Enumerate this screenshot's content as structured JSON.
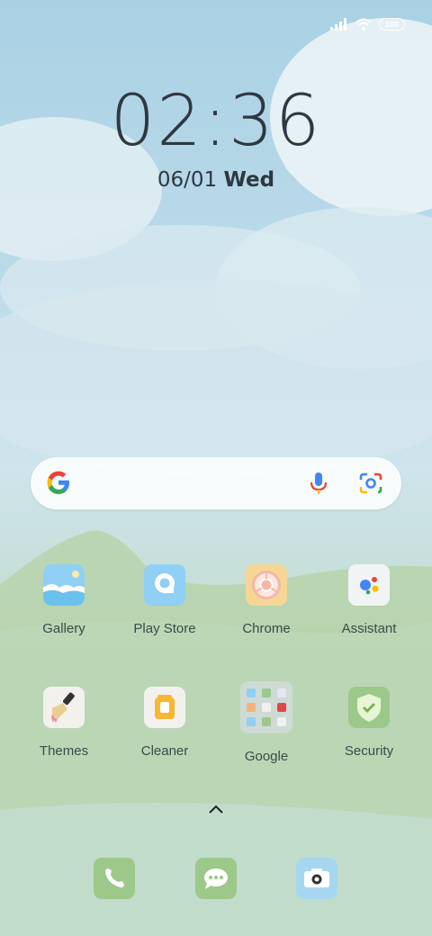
{
  "status_bar": {
    "badge": "100"
  },
  "lock": {
    "time": "02:36",
    "date": "06/01",
    "weekday": "Wed"
  },
  "search": {
    "provider": "Google"
  },
  "apps_row1": [
    {
      "label": "Gallery"
    },
    {
      "label": "Play Store"
    },
    {
      "label": "Chrome"
    },
    {
      "label": "Assistant"
    }
  ],
  "apps_row2": [
    {
      "label": "Themes"
    },
    {
      "label": "Cleaner"
    },
    {
      "label": "Google"
    },
    {
      "label": "Security"
    }
  ],
  "colors": {
    "sky": "#a9d1e4",
    "grass": "#b6d3b4",
    "text": "#2e3840",
    "label": "#3a4a4a",
    "tile_green": "#9cc88a",
    "tile_blue": "#a7d7f0"
  },
  "icons": [
    "wifi-icon",
    "signal-icon",
    "google-g-icon",
    "mic-icon",
    "lens-icon",
    "chevron-up-icon",
    "phone-icon",
    "messages-icon",
    "camera-icon"
  ]
}
